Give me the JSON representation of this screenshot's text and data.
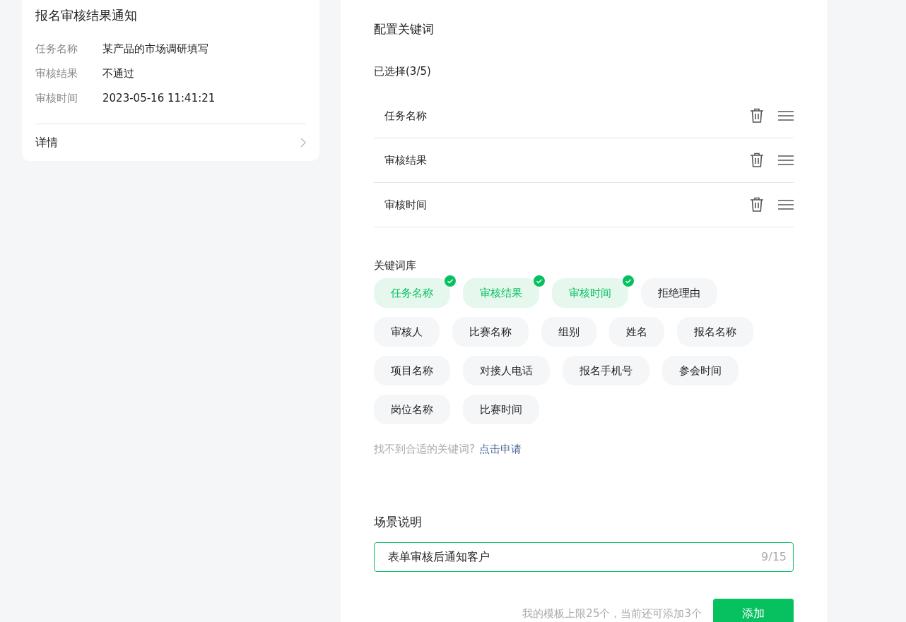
{
  "notice_card": {
    "title": "报名审核结果通知",
    "fields": [
      {
        "label": "任务名称",
        "value": "某产品的市场调研填写"
      },
      {
        "label": "审核结果",
        "value": "不通过"
      },
      {
        "label": "审核时间",
        "value": "2023-05-16 11:41:21"
      }
    ],
    "details_link": "详情"
  },
  "config": {
    "title": "配置关键词",
    "selected_label": "已选择(3/5)",
    "selected_items": [
      "任务名称",
      "审核结果",
      "审核时间"
    ],
    "library_label": "关键词库",
    "library": [
      {
        "label": "任务名称",
        "selected": true
      },
      {
        "label": "审核结果",
        "selected": true
      },
      {
        "label": "审核时间",
        "selected": true
      },
      {
        "label": "拒绝理由",
        "selected": false
      },
      {
        "label": "审核人",
        "selected": false
      },
      {
        "label": "比赛名称",
        "selected": false
      },
      {
        "label": "组别",
        "selected": false
      },
      {
        "label": "姓名",
        "selected": false
      },
      {
        "label": "报名名称",
        "selected": false
      },
      {
        "label": "项目名称",
        "selected": false
      },
      {
        "label": "对接人电话",
        "selected": false
      },
      {
        "label": "报名手机号",
        "selected": false
      },
      {
        "label": "参会时间",
        "selected": false
      },
      {
        "label": "岗位名称",
        "selected": false
      },
      {
        "label": "比赛时间",
        "selected": false
      }
    ],
    "hint": "找不到合适的关键词?",
    "apply_link": "点击申请"
  },
  "scene": {
    "label": "场景说明",
    "value": "表单审核后通知客户",
    "counter": "9/15"
  },
  "footer": {
    "limit_note": "我的模板上限25个，当前还可添加3个",
    "add_button": "添加"
  }
}
